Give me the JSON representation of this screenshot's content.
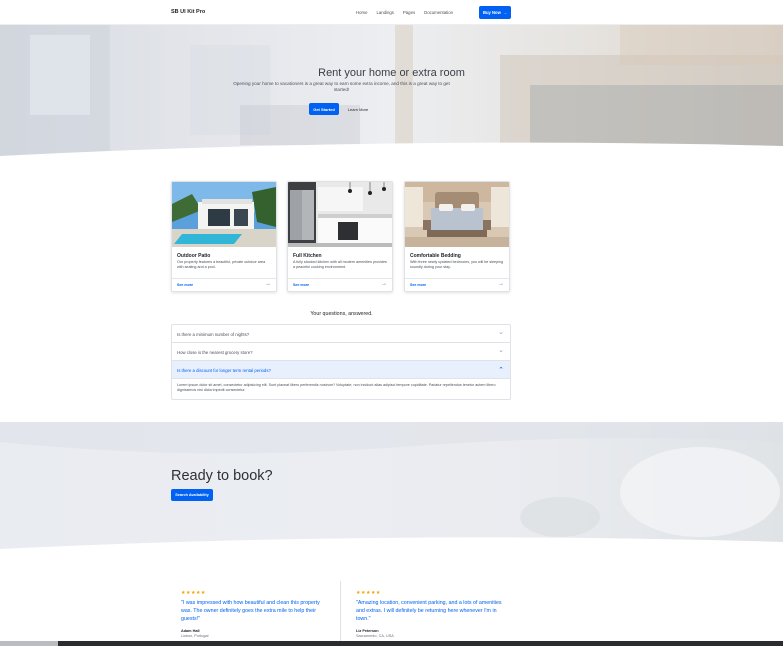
{
  "navbar": {
    "brand": "SB UI Kit Pro",
    "links": [
      "Home",
      "Landings",
      "Pages",
      "Documentation"
    ],
    "buy_button": "Buy Now"
  },
  "hero": {
    "title": "Rent your home or extra room",
    "subtitle": "Opening your home to vacationers is a great way to earn some extra income, and this is a great way to get started!",
    "primary_button": "Get Started",
    "secondary_button": "Learn More"
  },
  "cards": [
    {
      "title": "Outdoor Patio",
      "text": "Our property features a beautiful, private outdoor area with seating and a pool.",
      "link": "See more",
      "image_icon": "patio-image"
    },
    {
      "title": "Full Kitchen",
      "text": "A fully stocked kitchen with all modern amenities provides a peaceful cooking environment.",
      "link": "See more",
      "image_icon": "kitchen-image"
    },
    {
      "title": "Comfortable Bedding",
      "text": "With three newly updated bedrooms, you will be sleeping soundly during your stay.",
      "link": "See more",
      "image_icon": "bedroom-image"
    }
  ],
  "faq": {
    "title": "Your questions, answered.",
    "items": [
      {
        "question": "Is there a minimum number of nights?"
      },
      {
        "question": "How close is the nearest grocery store?"
      },
      {
        "question": "Is there a discount for longer term rental periods?"
      }
    ],
    "open_answer": "Lorem ipsum dolor sit amet, consectetur adipisicing elit. Sunt placeat libero perferendis nostrum? Voluptate, non incidunt alias adipisci tempore cupiditate. Pariatur repellendus tenetur autem libero dignissimos nisi dicta impedit consectetur."
  },
  "cta": {
    "title": "Ready to book?",
    "button": "Search Availability"
  },
  "testimonials": [
    {
      "stars": "★★★★★",
      "quote": "\"I was impressed with how beautiful and clean this property was. The owner definitely goes the extra mile to help their guests!\"",
      "author": "Adam Hall",
      "location": "Lisbon, Portugal"
    },
    {
      "stars": "★★★★★",
      "quote": "\"Amazing location, convenient parking, and a lots of amenities and extras. I will definitely be returning here whenever I'm in town.\"",
      "author": "Liz Peterson",
      "location": "Sacramento, CA, USA"
    }
  ],
  "colors": {
    "primary": "#0061f2",
    "star": "#f4a100"
  }
}
